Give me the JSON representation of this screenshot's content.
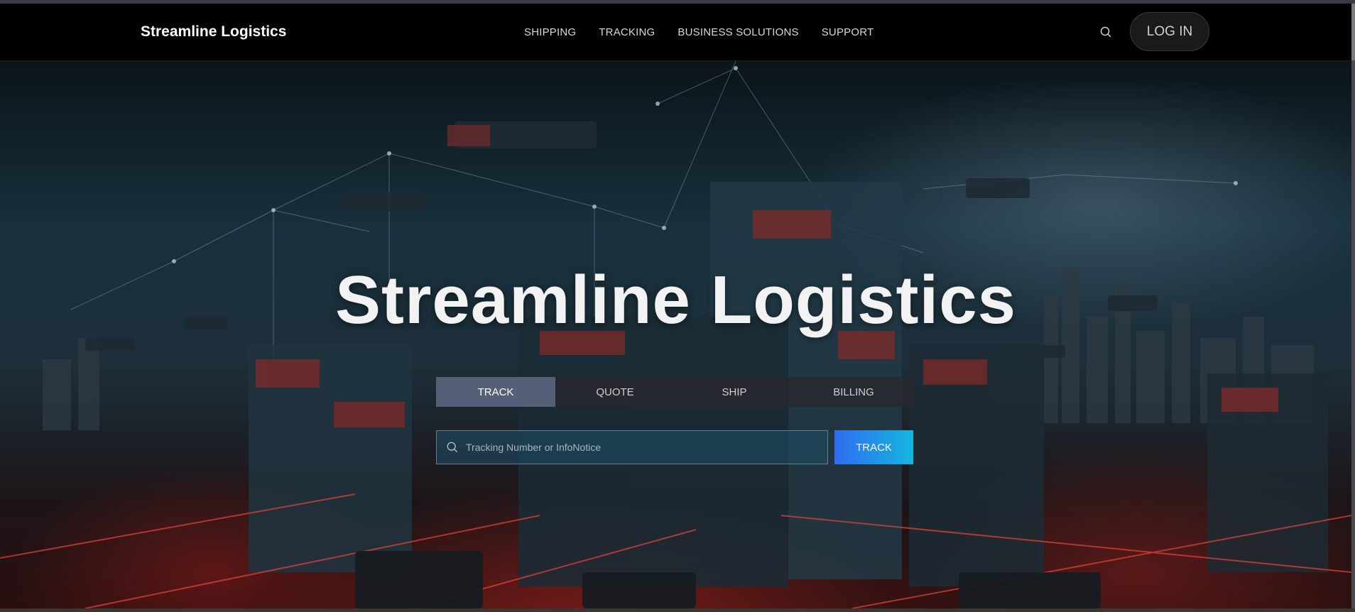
{
  "nav": {
    "brand": "Streamline Logistics",
    "links": [
      "SHIPPING",
      "TRACKING",
      "BUSINESS SOLUTIONS",
      "SUPPORT"
    ],
    "search_icon": "search-icon",
    "login_label": "LOG IN"
  },
  "hero": {
    "title": "Streamline Logistics",
    "tabs": [
      {
        "label": "TRACK",
        "active": true
      },
      {
        "label": "QUOTE",
        "active": false
      },
      {
        "label": "SHIP",
        "active": false
      },
      {
        "label": "BILLING",
        "active": false
      }
    ],
    "track_input": {
      "placeholder": "Tracking Number or InfoNotice",
      "value": ""
    },
    "track_button": "TRACK"
  },
  "colors": {
    "nav_bg": "#000000",
    "active_tab": "#6e7da0",
    "button_gradient_start": "#2f6cf0",
    "button_gradient_end": "#14b7e0"
  }
}
